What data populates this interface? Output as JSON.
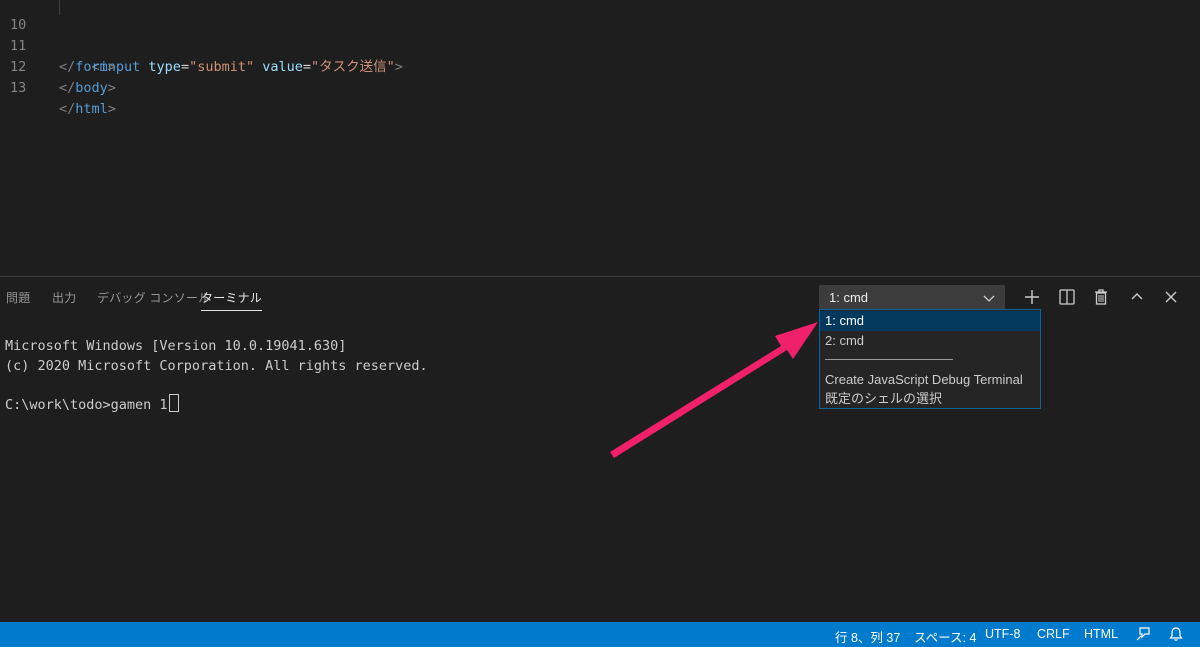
{
  "editor": {
    "lines": [
      {
        "num": "10",
        "indent": "    ",
        "lt": "<",
        "tag": "input",
        "attr1": " type",
        "val1": "\"submit\"",
        "attr2": " value",
        "val2": "\"タスク送信\"",
        "gt": ">"
      },
      {
        "num": "11",
        "lt": "</",
        "tag": "form",
        "gt": ">"
      },
      {
        "num": "12",
        "lt": "</",
        "tag": "body",
        "gt": ">"
      },
      {
        "num": "13",
        "lt": "</",
        "tag": "html",
        "gt": ">"
      }
    ]
  },
  "panel": {
    "tabs": [
      {
        "label": "問題"
      },
      {
        "label": "出力"
      },
      {
        "label": "デバッグ コンソール"
      },
      {
        "label": "ターミナル",
        "active": true
      }
    ],
    "terminal_select": {
      "value": "1: cmd"
    },
    "tools": [
      "plus-icon",
      "split-icon",
      "trash-icon",
      "chevron-up-icon",
      "close-icon"
    ],
    "terminal": {
      "line1": "Microsoft Windows [Version 10.0.19041.630]",
      "line2": "(c) 2020 Microsoft Corporation. All rights reserved.",
      "prompt": "C:\\work\\todo>gamen 1"
    },
    "dropdown": {
      "options": [
        "1: cmd",
        "2: cmd"
      ],
      "separator": "──────────────",
      "actions": [
        "Create JavaScript Debug Terminal",
        "既定のシェルの選択"
      ]
    }
  },
  "status_bar": {
    "position": "行 8、列 37",
    "spaces": "スペース: 4",
    "encoding": "UTF-8",
    "eol": "CRLF",
    "language": "HTML"
  },
  "colors": {
    "status_bar": "#007acc",
    "arrow": "#f0206a",
    "dropdown_selected": "#04395e"
  }
}
